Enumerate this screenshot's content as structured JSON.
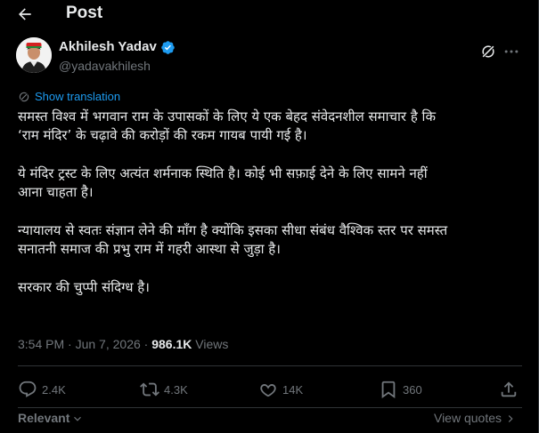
{
  "header": {
    "title": "Post"
  },
  "author": {
    "name": "Akhilesh Yadav",
    "handle": "@yadavakhilesh"
  },
  "translate_label": "Show translation",
  "tweet": {
    "paragraphs": [
      "समस्त विश्व में भगवान राम के उपासकों के लिए ये एक बेहद संवेदनशील समाचार है कि\n‘राम मंदिर’ के चढ़ावे की करोड़ों की रकम गायब पायी गई है।",
      "ये मंदिर ट्रस्ट के लिए अत्यंत शर्मनाक स्थिति है। कोई भी सफ़ाई देने के लिए सामने नहीं\nआना चाहता है।",
      "न्यायालय से स्वतः संज्ञान लेने की माँग है क्योंकि इसका सीधा संबंध वैश्विक स्तर पर समस्त\nसनातनी समाज की प्रभु राम में गहरी आस्था से जुड़ा है।",
      "सरकार की चुप्पी संदिग्ध है।"
    ]
  },
  "meta": {
    "time": "3:54 PM",
    "separator": " · ",
    "date": "Jun 7, 2026",
    "views_count": "986.1K",
    "views_label": " Views"
  },
  "actions": {
    "replies": "2.4K",
    "reposts": "4.3K",
    "likes": "14K",
    "bookmarks": "360"
  },
  "footer": {
    "relevant_label": "Relevant",
    "view_quotes_label": "View quotes"
  },
  "icons": {
    "back": "arrow-left-icon",
    "verified": "verified-badge-icon",
    "grok": "grok-icon",
    "more": "more-icon",
    "translate": "translate-icon",
    "reply": "reply-icon",
    "repost": "repost-icon",
    "like": "heart-icon",
    "bookmark": "bookmark-icon",
    "share": "share-icon"
  },
  "colors": {
    "background": "#000000",
    "text": "#e7e9ea",
    "muted": "#71767b",
    "accent": "#1d9bf0",
    "border": "#2f3336"
  }
}
